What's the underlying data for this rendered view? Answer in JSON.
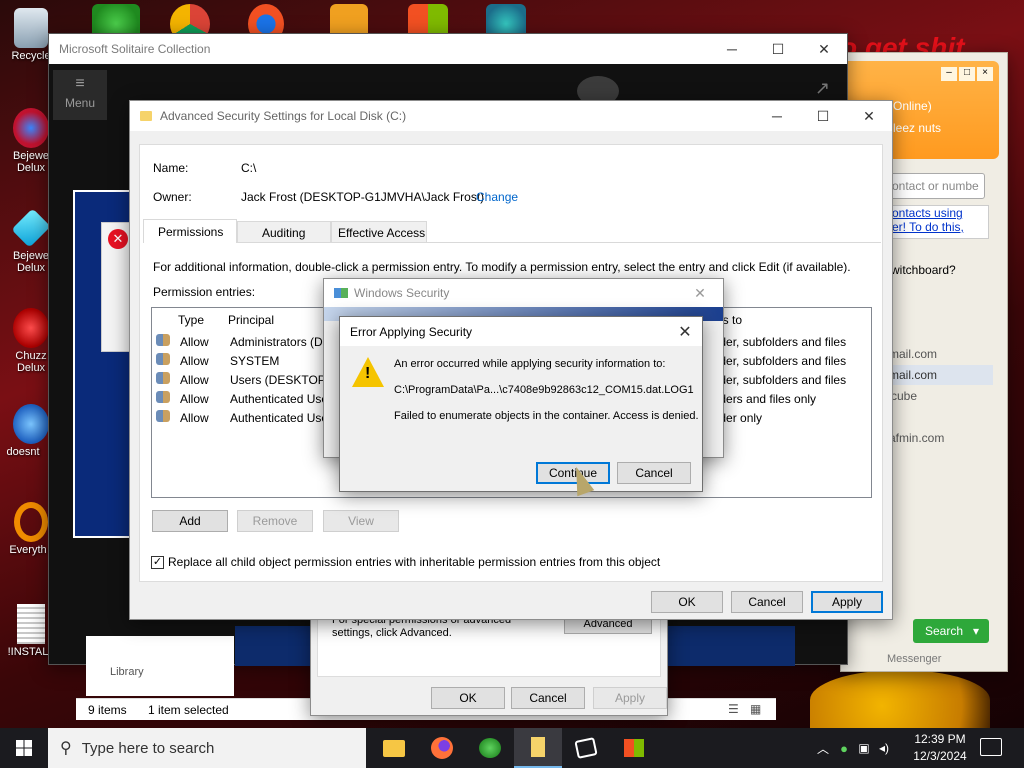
{
  "desktop": {
    "icons": [
      {
        "label": "Recycle",
        "icon": "recycle-bin-icon"
      },
      {
        "label": "Bejewe Delux",
        "icon": "bejeweled-icon"
      },
      {
        "label": "Bejewe Delux",
        "icon": "gem-icon"
      },
      {
        "label": "Chuzz Delux",
        "icon": "chuzzle-icon"
      },
      {
        "label": "doesnt",
        "icon": "bird-icon"
      },
      {
        "label": "Everyth",
        "icon": "search-app-icon"
      },
      {
        "label": "!INSTAL",
        "icon": "document-icon"
      }
    ],
    "wallpaper_text": "o get shit"
  },
  "solitaire": {
    "title": "Microsoft Solitaire Collection",
    "menu_label": "Menu"
  },
  "messenger": {
    "status_lines": [
      "Online)",
      "leez nuts"
    ],
    "search_placeholder": "ontact or numbe",
    "links": [
      "ontacts using",
      "er! To do this,"
    ],
    "switchboard": "witchboard?",
    "emails": [
      "mail.com",
      "mail.com",
      "cube",
      "afmin.com"
    ],
    "search_label": "Search",
    "footer": "Messenger"
  },
  "explorer": {
    "status_items": "9 items",
    "status_selected": "1 item selected",
    "library": "Library"
  },
  "properties": {
    "advanced_text": "For special permissions or advanced settings, click Advanced.",
    "advanced_button": "Advanced",
    "ok": "OK",
    "cancel": "Cancel",
    "apply": "Apply"
  },
  "advsec": {
    "title": "Advanced Security Settings for Local Disk (C:)",
    "name_label": "Name:",
    "name_value": "C:\\",
    "owner_label": "Owner:",
    "owner_value": "Jack Frost (DESKTOP-G1JMVHA\\Jack Frost)",
    "change_link": "Change",
    "tabs": [
      "Permissions",
      "Auditing",
      "Effective Access"
    ],
    "info_text": "For additional information, double-click a permission entry. To modify a permission entry, select the entry and click Edit (if available).",
    "entries_label": "Permission entries:",
    "columns": [
      "Type",
      "Principal",
      "es to"
    ],
    "rows": [
      {
        "type": "Allow",
        "principal": "Administrators (DE",
        "applies": "older, subfolders and files"
      },
      {
        "type": "Allow",
        "principal": "SYSTEM",
        "applies": "older, subfolders and files"
      },
      {
        "type": "Allow",
        "principal": "Users (DESKTOP-G",
        "applies": "older, subfolders and files"
      },
      {
        "type": "Allow",
        "principal": "Authenticated Use",
        "applies": "olders and files only"
      },
      {
        "type": "Allow",
        "principal": "Authenticated Use",
        "applies": "older only"
      }
    ],
    "add": "Add",
    "remove": "Remove",
    "view": "View",
    "replace_checkbox": "Replace all child object permission entries with inheritable permission entries from this object",
    "ok": "OK",
    "cancel": "Cancel",
    "apply": "Apply"
  },
  "winsec": {
    "title": "Windows Security"
  },
  "error": {
    "title": "Error Applying Security",
    "line1": "An error occurred while applying security information to:",
    "path": "C:\\ProgramData\\Pa...\\c7408e9b92863c12_COM15.dat.LOG1",
    "line2": "Failed to enumerate objects in the container. Access is denied.",
    "continue": "Continue",
    "cancel": "Cancel"
  },
  "taskbar": {
    "search_placeholder": "Type here to search",
    "time": "12:39 PM",
    "date": "12/3/2024"
  },
  "colors": {
    "accent": "#0078d7",
    "link": "#0066cc",
    "warning": "#f5c400"
  }
}
